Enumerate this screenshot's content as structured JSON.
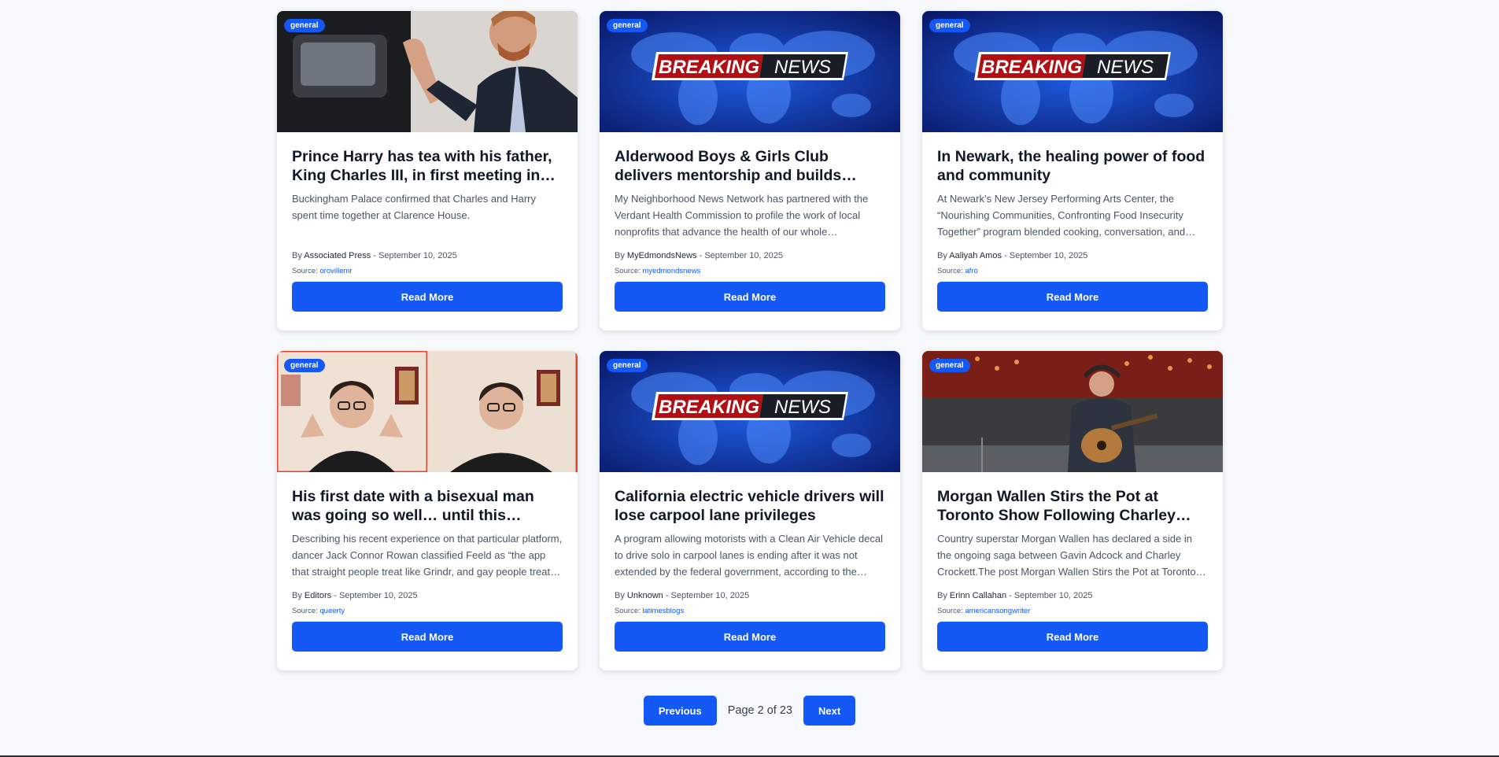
{
  "articles": [
    {
      "category": "general",
      "image": "man-waving-photo",
      "title": "Prince Harry has tea with his father, King Charles III, in first meeting in…",
      "description": "Buckingham Palace confirmed that Charles and Harry spent time together at Clarence House.",
      "by_prefix": "By",
      "author": "Associated Press",
      "date": "- September 10, 2025",
      "source_label": "Source:",
      "source": "orovillemr",
      "button": "Read More"
    },
    {
      "category": "general",
      "image": "breaking-news-banner",
      "title": "Alderwood Boys & Girls Club delivers mentorship and builds…",
      "description": "My Neighborhood News Network has partnered with the Verdant Health Commission to profile the work of local nonprofits that advance the health of our whole community…",
      "by_prefix": "By",
      "author": "MyEdmondsNews",
      "date": "- September 10, 2025",
      "source_label": "Source:",
      "source": "myedmondsnews",
      "button": "Read More"
    },
    {
      "category": "general",
      "image": "breaking-news-banner",
      "title": "In Newark, the healing power of food and community",
      "description": "At Newark’s New Jersey Performing Arts Center, the “Nourishing Communities, Confronting Food Insecurity Together” program blended cooking, conversation, and…",
      "by_prefix": "By",
      "author": "Aaliyah Amos",
      "date": "- September 10, 2025",
      "source_label": "Source:",
      "source": "afro",
      "button": "Read More"
    },
    {
      "category": "general",
      "image": "man-talking-split-photo",
      "title": "His first date with a bisexual man was going so well… until this hellis…",
      "description": "Describing his recent experience on that particular platform, dancer Jack Connor Rowan classified Feeld as “the app that straight people treat like Grindr, and gay people treat like…",
      "by_prefix": "By",
      "author": "Editors",
      "date": "- September 10, 2025",
      "source_label": "Source:",
      "source": "queerty",
      "button": "Read More"
    },
    {
      "category": "general",
      "image": "breaking-news-banner",
      "title": "California electric vehicle drivers will lose carpool lane privileges",
      "description": "A program allowing motorists with a Clean Air Vehicle decal to drive solo in carpool lanes is ending after it was not extended by the federal government, according to the…",
      "by_prefix": "By",
      "author": "Unknown",
      "date": "- September 10, 2025",
      "source_label": "Source:",
      "source": "latimesblogs",
      "button": "Read More"
    },
    {
      "category": "general",
      "image": "singer-on-stage-photo",
      "title": "Morgan Wallen Stirs the Pot at Toronto Show Following Charley…",
      "description": "Country superstar Morgan Wallen has declared a side in the ongoing saga between Gavin Adcock and Charley Crockett.The post Morgan Wallen Stirs the Pot at Toronto…",
      "by_prefix": "By",
      "author": "Erinn Callahan",
      "date": "- September 10, 2025",
      "source_label": "Source:",
      "source": "americansongwriter",
      "button": "Read More"
    }
  ],
  "banner_text": {
    "breaking": "BREAKING",
    "news": "NEWS"
  },
  "pagination": {
    "previous": "Previous",
    "status": "Page 2 of 23",
    "next": "Next"
  },
  "colors": {
    "accent": "#1458f5",
    "background": "#f7f9fc"
  }
}
